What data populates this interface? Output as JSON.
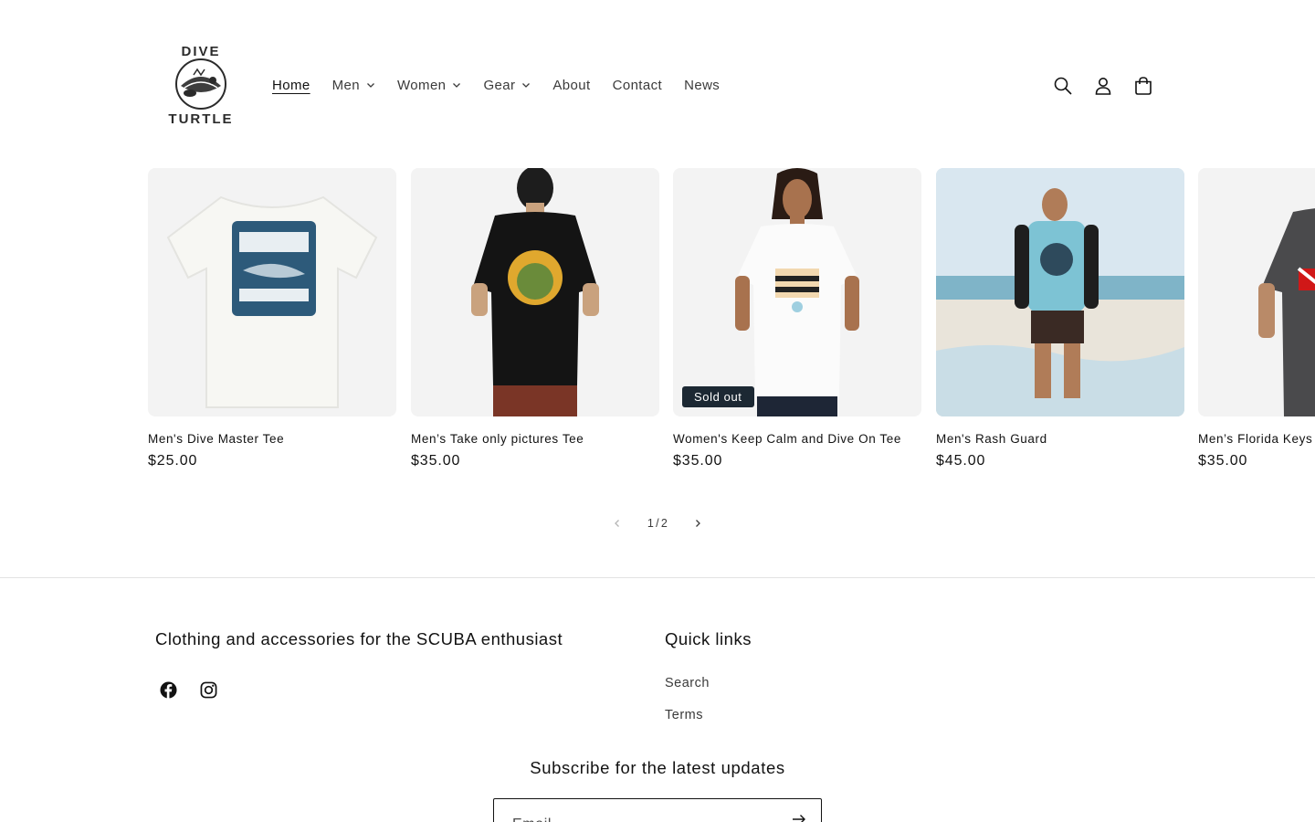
{
  "brand": {
    "name_line1": "DIVE",
    "name_line2": "TURTLE"
  },
  "nav": {
    "items": [
      {
        "label": "Home",
        "active": true,
        "dropdown": false
      },
      {
        "label": "Men",
        "active": false,
        "dropdown": true
      },
      {
        "label": "Women",
        "active": false,
        "dropdown": true
      },
      {
        "label": "Gear",
        "active": false,
        "dropdown": true
      },
      {
        "label": "About",
        "active": false,
        "dropdown": false
      },
      {
        "label": "Contact",
        "active": false,
        "dropdown": false
      },
      {
        "label": "News",
        "active": false,
        "dropdown": false
      }
    ]
  },
  "header_icons": [
    "search-icon",
    "account-icon",
    "cart-icon"
  ],
  "products": [
    {
      "title": "Men's Dive Master Tee",
      "price": "$25.00",
      "badge": ""
    },
    {
      "title": "Men’s Take only pictures Tee",
      "price": "$35.00",
      "badge": ""
    },
    {
      "title": "Women's Keep Calm and Dive On Tee",
      "price": "$35.00",
      "badge": "Sold out"
    },
    {
      "title": "Men's Rash Guard",
      "price": "$45.00",
      "badge": ""
    },
    {
      "title": "Men’s Florida Keys",
      "price": "$35.00",
      "badge": ""
    }
  ],
  "pager": {
    "current": "1",
    "separator": "/",
    "total": "2"
  },
  "footer": {
    "tagline": "Clothing and accessories for the SCUBA enthusiast",
    "social": [
      "facebook-icon",
      "instagram-icon"
    ],
    "quick_links_title": "Quick links",
    "quick_links": [
      "Search",
      "Terms"
    ],
    "subscribe_title": "Subscribe for the latest updates",
    "email_placeholder": "Email"
  },
  "colors": {
    "text": "#121212",
    "muted": "#3b3b3b",
    "badge_bg": "#1c2833",
    "card_bg": "#f3f3f3"
  }
}
